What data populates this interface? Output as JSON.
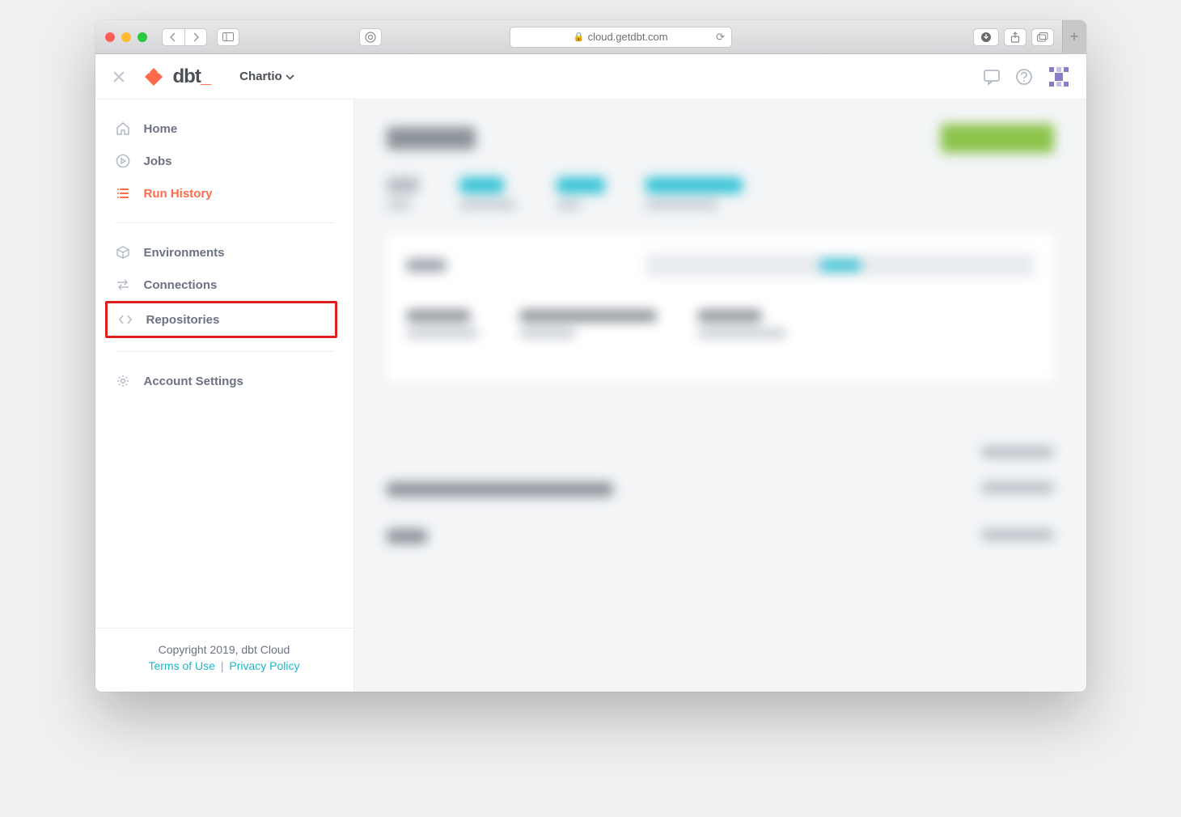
{
  "browser": {
    "url_host": "cloud.getdbt.com"
  },
  "header": {
    "logo_text": "dbt",
    "org_name": "Chartio"
  },
  "sidebar": {
    "items": [
      {
        "key": "home",
        "label": "Home",
        "active": false
      },
      {
        "key": "jobs",
        "label": "Jobs",
        "active": false
      },
      {
        "key": "run-history",
        "label": "Run History",
        "active": true
      }
    ],
    "items2": [
      {
        "key": "environments",
        "label": "Environments"
      },
      {
        "key": "connections",
        "label": "Connections"
      },
      {
        "key": "repositories",
        "label": "Repositories",
        "highlighted": true
      }
    ],
    "items3": [
      {
        "key": "account-settings",
        "label": "Account Settings"
      }
    ]
  },
  "footer": {
    "copyright": "Copyright 2019, dbt Cloud",
    "terms": "Terms of Use",
    "privacy": "Privacy Policy"
  }
}
